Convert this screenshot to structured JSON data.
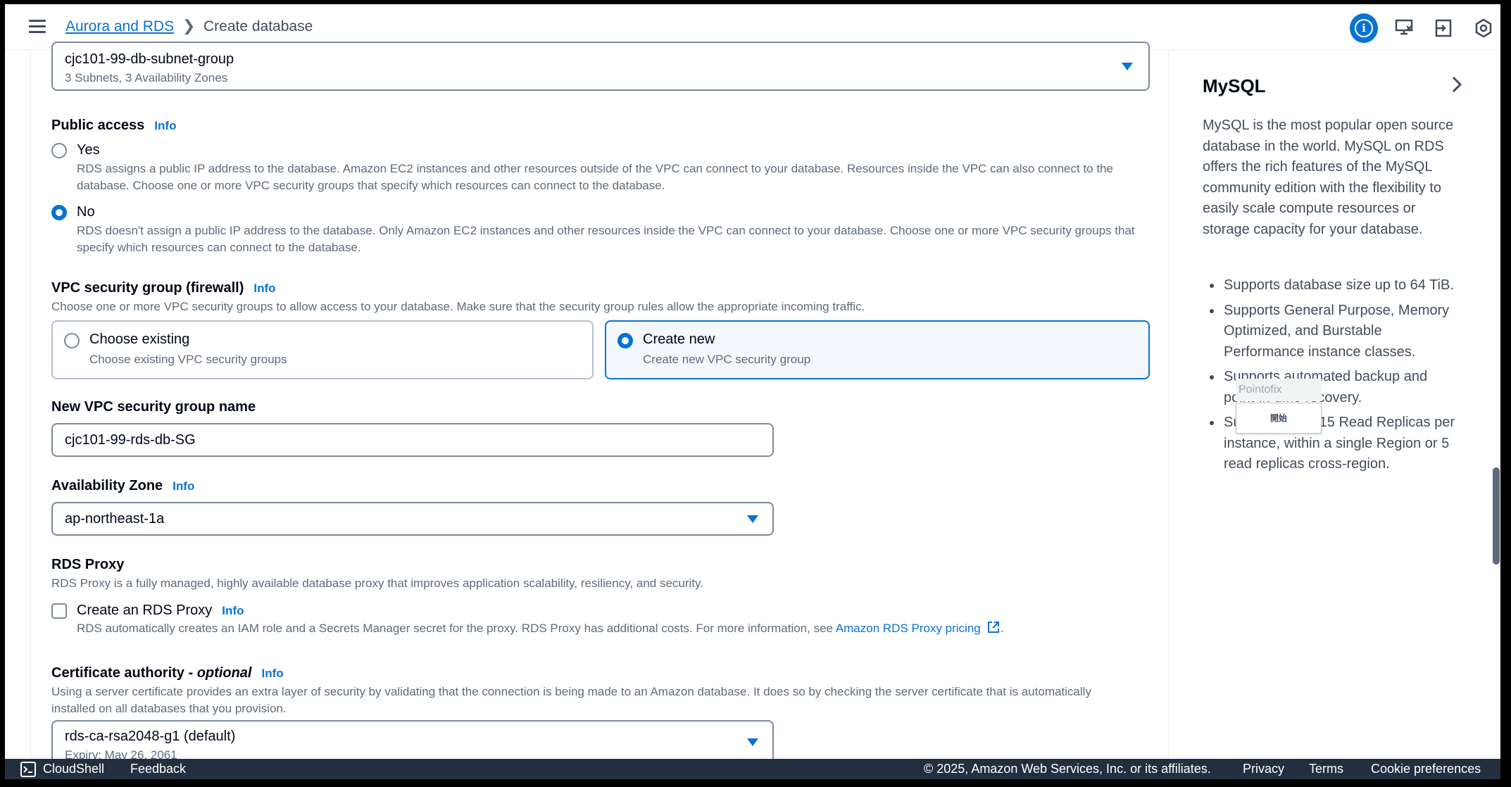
{
  "topbar": {
    "breadcrumb_parent": "Aurora and RDS",
    "breadcrumb_current": "Create database"
  },
  "subnet_group": {
    "value": "cjc101-99-db-subnet-group",
    "subtext": "3 Subnets, 3 Availability Zones"
  },
  "public_access": {
    "label": "Public access",
    "info": "Info",
    "yes_label": "Yes",
    "yes_desc": "RDS assigns a public IP address to the database. Amazon EC2 instances and other resources outside of the VPC can connect to your database. Resources inside the VPC can also connect to the database. Choose one or more VPC security groups that specify which resources can connect to the database.",
    "no_label": "No",
    "no_desc": "RDS doesn't assign a public IP address to the database. Only Amazon EC2 instances and other resources inside the VPC can connect to your database. Choose one or more VPC security groups that specify which resources can connect to the database.",
    "selected": "No"
  },
  "vpc_sg": {
    "label": "VPC security group (firewall)",
    "info": "Info",
    "desc": "Choose one or more VPC security groups to allow access to your database. Make sure that the security group rules allow the appropriate incoming traffic.",
    "existing_label": "Choose existing",
    "existing_desc": "Choose existing VPC security groups",
    "new_label": "Create new",
    "new_desc": "Create new VPC security group",
    "selected": "Create new"
  },
  "new_sg_name": {
    "label": "New VPC security group name",
    "value": "cjc101-99-rds-db-SG"
  },
  "availability_zone": {
    "label": "Availability Zone",
    "info": "Info",
    "value": "ap-northeast-1a"
  },
  "rds_proxy": {
    "label": "RDS Proxy",
    "desc": "RDS Proxy is a fully managed, highly available database proxy that improves application scalability, resiliency, and security.",
    "checkbox_label": "Create an RDS Proxy",
    "info": "Info",
    "checkbox_desc": "RDS automatically creates an IAM role and a Secrets Manager secret for the proxy. RDS Proxy has additional costs. For more information, see",
    "pricing_link": "Amazon RDS Proxy pricing",
    "checked": false
  },
  "certificate": {
    "label": "Certificate authority -",
    "label_optional": "optional",
    "info": "Info",
    "desc": "Using a server certificate provides an extra layer of security by validating that the connection is being made to an Amazon database. It does so by checking the server certificate that is automatically installed on all databases that you provision.",
    "value": "rds-ca-rsa2048-g1 (default)",
    "subtext": "Expiry: May 26, 2061"
  },
  "side_panel": {
    "title": "MySQL",
    "paragraph": "MySQL is the most popular open source database in the world. MySQL on RDS offers the rich features of the MySQL community edition with the flexibility to easily scale compute resources or storage capacity for your database.",
    "bullets": [
      "Supports database size up to 64 TiB.",
      "Supports General Purpose, Memory Optimized, and Burstable Performance instance classes.",
      "Supports automated backup and point-in-time recovery.",
      "Supports up to 15 Read Replicas per instance, within a single Region or 5 read replicas cross-region."
    ]
  },
  "overlay": {
    "title": "Pointofix",
    "button": "開始"
  },
  "footer": {
    "cloudshell": "CloudShell",
    "feedback": "Feedback",
    "copyright": "© 2025, Amazon Web Services, Inc. or its affiliates.",
    "privacy": "Privacy",
    "terms": "Terms",
    "cookie": "Cookie preferences"
  }
}
